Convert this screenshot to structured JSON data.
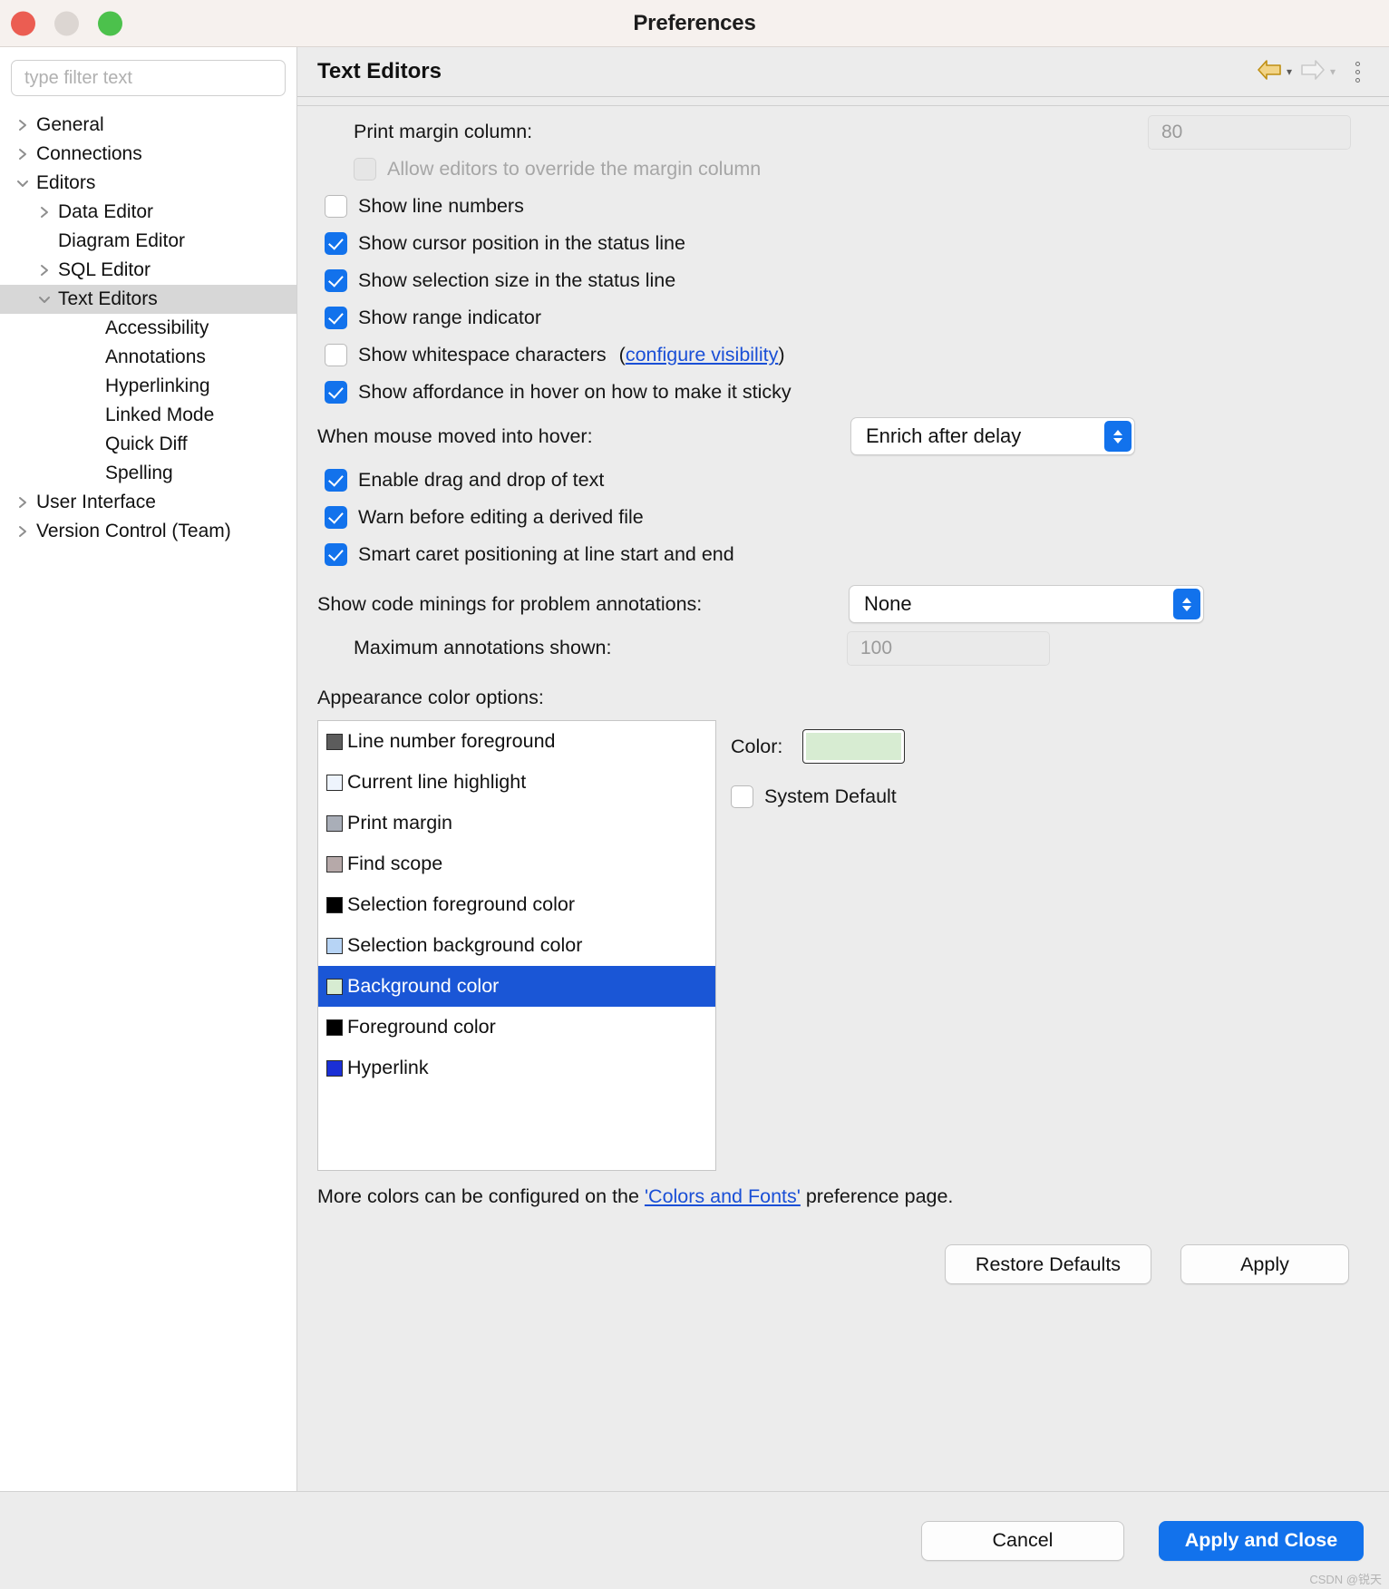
{
  "window": {
    "title": "Preferences",
    "traffic_lights": [
      "close-red",
      "minimize-yellow",
      "zoom-green"
    ]
  },
  "sidebar": {
    "filter": {
      "placeholder": "type filter text",
      "value": ""
    },
    "items": [
      {
        "label": "General",
        "level": 0,
        "twisty": "collapsed",
        "selected": false
      },
      {
        "label": "Connections",
        "level": 0,
        "twisty": "collapsed",
        "selected": false
      },
      {
        "label": "Editors",
        "level": 0,
        "twisty": "expanded",
        "selected": false
      },
      {
        "label": "Data Editor",
        "level": 1,
        "twisty": "collapsed",
        "selected": false
      },
      {
        "label": "Diagram Editor",
        "level": 1,
        "twisty": "none",
        "selected": false
      },
      {
        "label": "SQL Editor",
        "level": 1,
        "twisty": "collapsed",
        "selected": false
      },
      {
        "label": "Text Editors",
        "level": 1,
        "twisty": "expanded",
        "selected": true
      },
      {
        "label": "Accessibility",
        "level": 2,
        "twisty": "none",
        "selected": false
      },
      {
        "label": "Annotations",
        "level": 2,
        "twisty": "none",
        "selected": false
      },
      {
        "label": "Hyperlinking",
        "level": 2,
        "twisty": "none",
        "selected": false
      },
      {
        "label": "Linked Mode",
        "level": 2,
        "twisty": "none",
        "selected": false
      },
      {
        "label": "Quick Diff",
        "level": 2,
        "twisty": "none",
        "selected": false
      },
      {
        "label": "Spelling",
        "level": 2,
        "twisty": "none",
        "selected": false
      },
      {
        "label": "User Interface",
        "level": 0,
        "twisty": "collapsed",
        "selected": false
      },
      {
        "label": "Version Control (Team)",
        "level": 0,
        "twisty": "collapsed",
        "selected": false
      }
    ]
  },
  "pane": {
    "title": "Text Editors",
    "back_enabled": true,
    "forward_enabled": false
  },
  "settings": {
    "print_margin_label": "Print margin column:",
    "print_margin_value": "80",
    "allow_override_label": "Allow editors to override the margin column",
    "allow_override_checked": false,
    "allow_override_enabled": false,
    "checkboxes": [
      {
        "label": "Show line numbers",
        "checked": false
      },
      {
        "label": "Show cursor position in the status line",
        "checked": true
      },
      {
        "label": "Show selection size in the status line",
        "checked": true
      },
      {
        "label": "Show range indicator",
        "checked": true
      }
    ],
    "whitespace": {
      "label": "Show whitespace characters",
      "checked": false,
      "link_open": "(",
      "link_text": "configure visibility",
      "link_close": ")"
    },
    "affordance": {
      "label": "Show affordance in hover on how to make it sticky",
      "checked": true
    },
    "hover_label": "When mouse moved into hover:",
    "hover_value": "Enrich after delay",
    "checkboxes2": [
      {
        "label": "Enable drag and drop of text",
        "checked": true
      },
      {
        "label": "Warn before editing a derived file",
        "checked": true
      },
      {
        "label": "Smart caret positioning at line start and end",
        "checked": true
      }
    ],
    "code_minings_label": "Show code minings for problem annotations:",
    "code_minings_value": "None",
    "max_annotations_label": "Maximum annotations shown:",
    "max_annotations_value": "100"
  },
  "appearance": {
    "heading": "Appearance color options:",
    "items": [
      {
        "label": "Line number foreground",
        "swatch": "#5c5c5c",
        "selected": false
      },
      {
        "label": "Current line highlight",
        "swatch": "#eef4fd",
        "selected": false
      },
      {
        "label": "Print margin",
        "swatch": "#a9aeb8",
        "selected": false
      },
      {
        "label": "Find scope",
        "swatch": "#b6a9a9",
        "selected": false
      },
      {
        "label": "Selection foreground color",
        "swatch": "#000000",
        "selected": false
      },
      {
        "label": "Selection background color",
        "swatch": "#b7d4f5",
        "selected": false
      },
      {
        "label": "Background color",
        "swatch": "#d7ecd2",
        "selected": true
      },
      {
        "label": "Foreground color",
        "swatch": "#000000",
        "selected": false
      },
      {
        "label": "Hyperlink",
        "swatch": "#1a2fd6",
        "selected": false
      }
    ],
    "color_label": "Color:",
    "color_value": "#d7ecd2",
    "system_default_label": "System Default",
    "system_default_checked": false,
    "note_prefix": "More colors can be configured on the ",
    "note_link": "'Colors and Fonts'",
    "note_suffix": " preference page."
  },
  "buttons": {
    "restore_defaults": "Restore Defaults",
    "apply": "Apply",
    "cancel": "Cancel",
    "apply_and_close": "Apply and Close"
  },
  "watermark": "CSDN @锐天",
  "colors": {
    "accent": "#1272ec",
    "selection": "#1a56d6",
    "link": "#1a4fd6",
    "back_arrow": "#d9a51f",
    "forward_arrow": "#cccccc"
  }
}
